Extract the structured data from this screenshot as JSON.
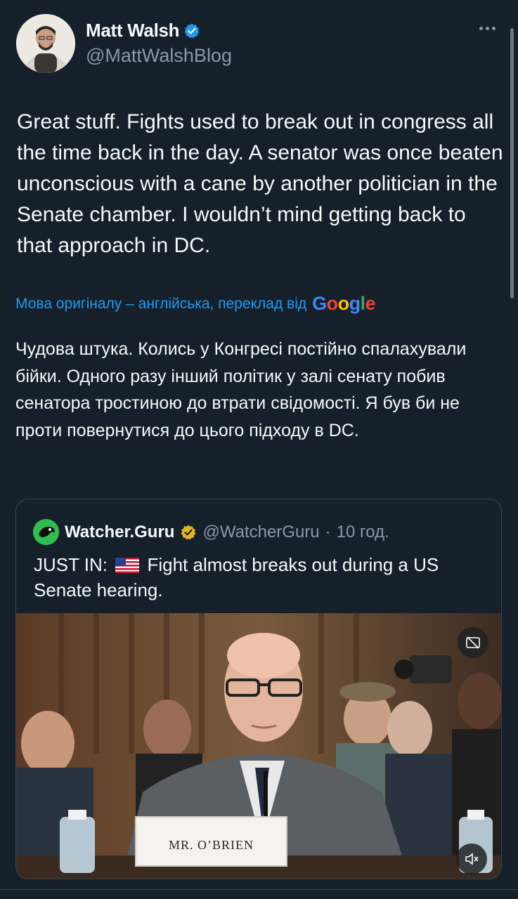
{
  "author": {
    "display_name": "Matt Walsh",
    "handle": "@MattWalshBlog",
    "verified_color": "#1d9bf0"
  },
  "tweet": {
    "text": "Great stuff. Fights used to break out in congress all the time back in the day. A senator was once beaten unconscious with a cane by another politician in the Senate chamber. I wouldn’t mind getting back to that approach in DC."
  },
  "translation": {
    "label": "Мова оригіналу – англійська, переклад від",
    "provider": "Google",
    "text": "Чудова штука. Колись у Конгресі постійно спалахували бійки. Одного разу інший політик у залі сенату побив сенатора тростиною до втрати свідомості. Я був би не проти повернутися до цього підходу в DC."
  },
  "quoted_tweet": {
    "display_name": "Watcher.Guru",
    "handle": "@WatcherGuru",
    "separator": "·",
    "time": "10 год.",
    "text_prefix": "JUST IN:",
    "flag": "us-flag",
    "text_rest": "Fight almost breaks out during a US Senate hearing.",
    "verified_color": "#e2b719",
    "media": {
      "nameplate": "MR. O’BRIEN",
      "icons": [
        "captions-off-icon",
        "muted-speaker-icon"
      ]
    }
  },
  "icons": [
    "verified-badge-icon",
    "more-options-icon"
  ],
  "colors": {
    "background": "#15202b",
    "text": "#f7f9f9",
    "secondary": "#8b98a5",
    "link": "#1d9bf0",
    "border": "#38444d"
  }
}
